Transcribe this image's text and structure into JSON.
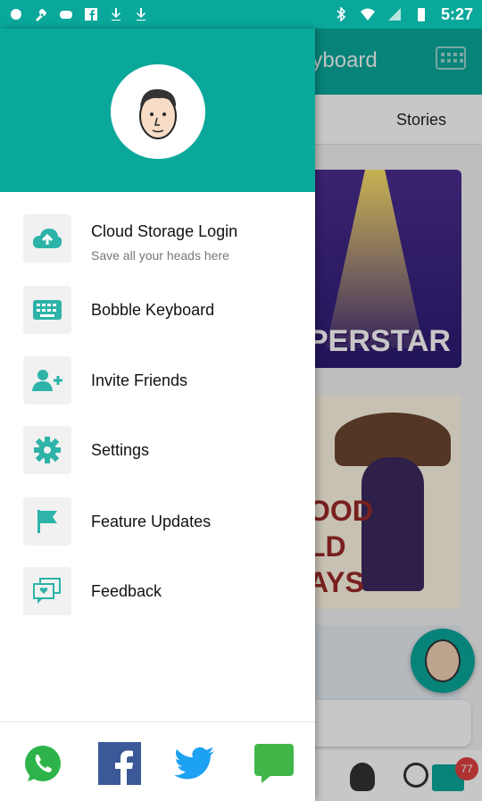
{
  "status_bar": {
    "time": "5:27",
    "left_icons": [
      "notification-icon",
      "wrench-icon",
      "game-icon",
      "facebook-icon",
      "download-icon",
      "download-icon"
    ],
    "right_icons": [
      "bluetooth-icon",
      "wifi-icon",
      "signal-icon",
      "battery-icon"
    ]
  },
  "background_app": {
    "title": "e Keyboard",
    "tab_label": "Stories",
    "card1_word": "PERSTAR",
    "card2_word": "OOD\nLD\nAYS",
    "store_badge": "77",
    "colors": {
      "primary": "#0aa89b",
      "badge": "#e04040"
    }
  },
  "drawer": {
    "header_color": "#0aa89b",
    "items": [
      {
        "label": "Cloud Storage Login",
        "sublabel": "Save all your heads here",
        "icon": "cloud-upload-icon"
      },
      {
        "label": "Bobble Keyboard",
        "icon": "keyboard-icon"
      },
      {
        "label": "Invite Friends",
        "icon": "add-friends-icon"
      },
      {
        "label": "Settings",
        "icon": "gear-icon"
      },
      {
        "label": "Feature Updates",
        "icon": "flag-icon"
      },
      {
        "label": "Feedback",
        "icon": "feedback-icon"
      }
    ],
    "footer_icons": [
      "whatsapp-icon",
      "facebook-icon",
      "twitter-icon",
      "message-icon"
    ],
    "icon_color": "#2db3a8"
  }
}
